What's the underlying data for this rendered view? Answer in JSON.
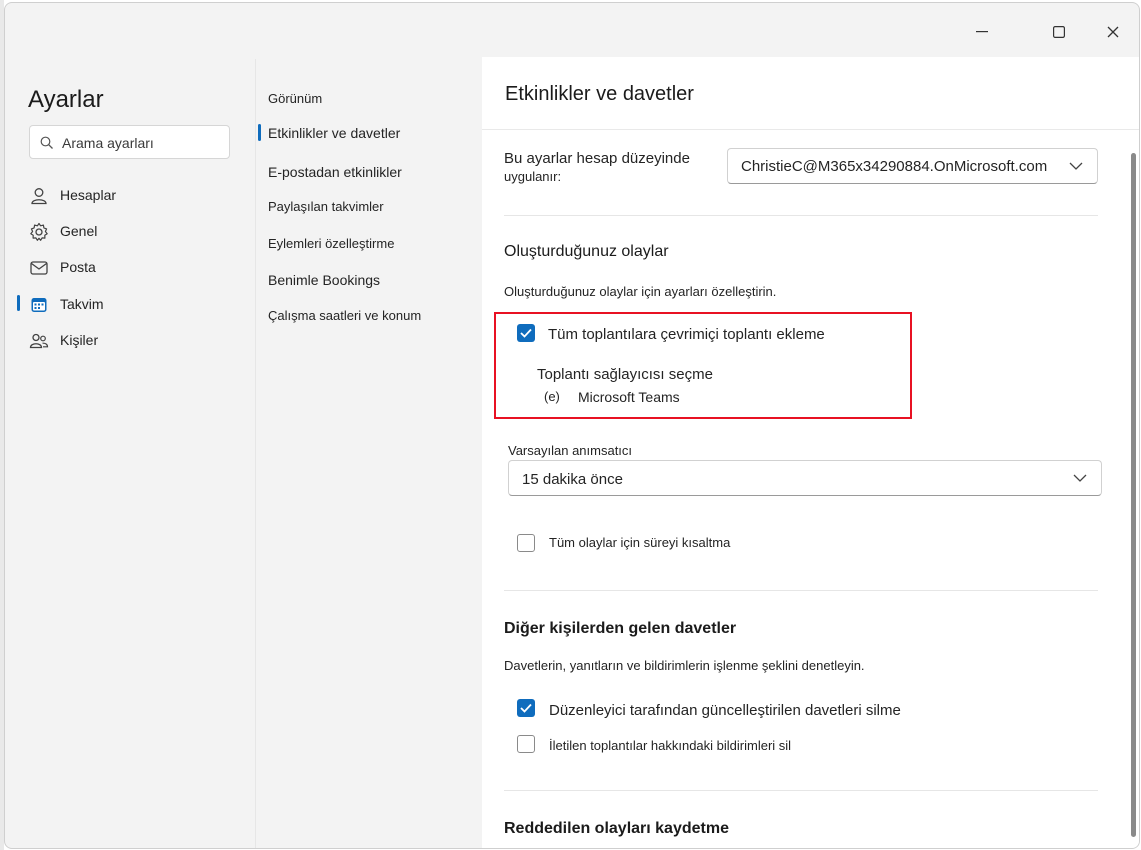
{
  "window": {
    "controls": {
      "minimize": "minimize",
      "maximize": "maximize",
      "close": "close"
    }
  },
  "sidebar": {
    "title": "Ayarlar",
    "search_placeholder": "Arama ayarları",
    "items": [
      {
        "label": "Hesaplar",
        "icon": "person-icon"
      },
      {
        "label": "Genel",
        "icon": "gear-icon"
      },
      {
        "label": "Posta",
        "icon": "mail-icon"
      },
      {
        "label": "Takvim",
        "icon": "calendar-icon",
        "selected": true
      },
      {
        "label": "Kişiler",
        "icon": "people-icon"
      }
    ]
  },
  "subnav": {
    "items": [
      {
        "label": "Görünüm"
      },
      {
        "label": "Etkinlikler ve davetler",
        "selected": true
      },
      {
        "label": "E-postadan etkinlikler"
      },
      {
        "label": "Paylaşılan takvimler"
      },
      {
        "label": "Eylemleri özelleştirme"
      },
      {
        "label": "Benimle Bookings"
      },
      {
        "label": "Çalışma saatleri ve konum"
      }
    ]
  },
  "main": {
    "title": "Etkinlikler ve davetler",
    "account": {
      "label_line1": "Bu ayarlar hesap düzeyinde",
      "label_line2": "uygulanır:",
      "value": "ChristieC@M365x34290884.OnMicrosoft.com"
    },
    "created_events": {
      "heading": "Oluşturduğunuz olaylar",
      "description": "Oluşturduğunuz olaylar için ayarları özelleştirin.",
      "online_meeting_checkbox": {
        "label": "Tüm toplantılara çevrimiçi toplantı ekleme",
        "checked": true
      },
      "provider_heading": "Toplantı sağlayıcısı seçme",
      "provider_marker": "(e)",
      "provider_option": "Microsoft Teams",
      "reminder_label": "Varsayılan anımsatıcı",
      "reminder_value_num": "15",
      "reminder_value_text": "dakika önce",
      "shorten_checkbox": {
        "label": "Tüm olaylar için süreyi kısaltma",
        "checked": false
      }
    },
    "invitations": {
      "heading": "Diğer kişilerden gelen davetler",
      "description": "Davetlerin, yanıtların ve bildirimlerin işlenme şeklini denetleyin.",
      "delete_updated_checkbox": {
        "label": "Düzenleyici tarafından güncelleştirilen davetleri silme",
        "checked": true
      },
      "delete_forwarded_checkbox": {
        "label": "İletilen toplantılar hakkındaki bildirimleri sil",
        "checked": false
      }
    },
    "declined": {
      "heading": "Reddedilen olayları kaydetme"
    }
  },
  "colors": {
    "accent": "#0f6cbd",
    "highlight_border": "#e81123",
    "window_bg": "#f3f3f3",
    "panel_bg": "#ffffff"
  }
}
